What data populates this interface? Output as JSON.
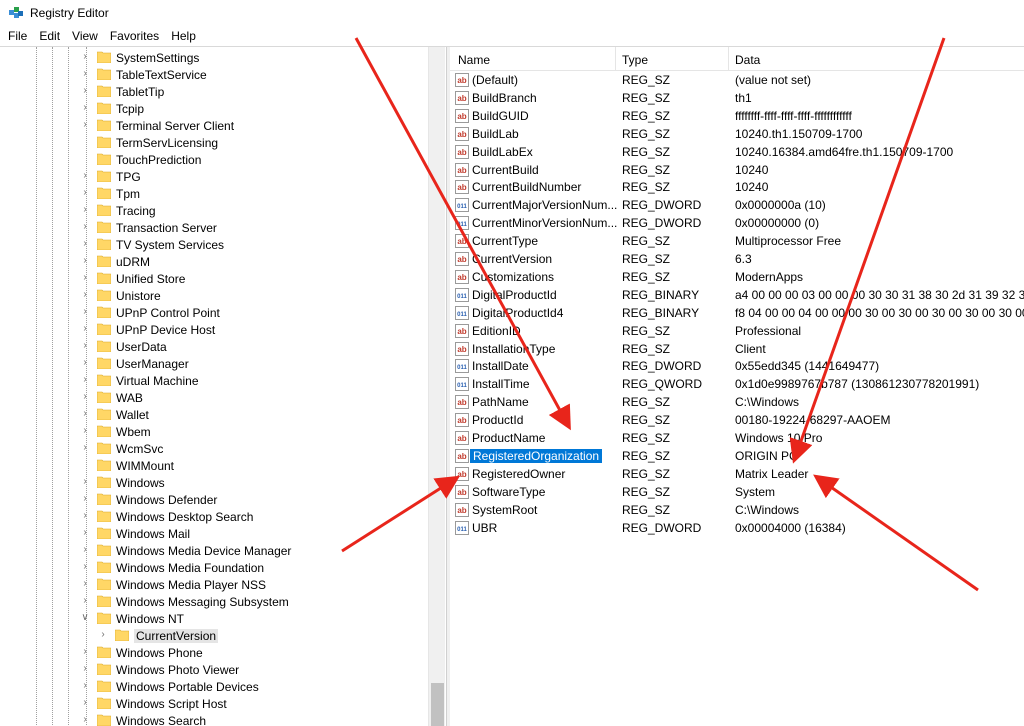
{
  "window": {
    "title": "Registry Editor",
    "icon": "regedit-icon"
  },
  "menu": [
    "File",
    "Edit",
    "View",
    "Favorites",
    "Help"
  ],
  "tree": {
    "items": [
      {
        "label": "SystemSettings",
        "expandable": true
      },
      {
        "label": "TableTextService",
        "expandable": true
      },
      {
        "label": "TabletTip",
        "expandable": true
      },
      {
        "label": "Tcpip",
        "expandable": true
      },
      {
        "label": "Terminal Server Client",
        "expandable": true
      },
      {
        "label": "TermServLicensing",
        "expandable": false
      },
      {
        "label": "TouchPrediction",
        "expandable": false
      },
      {
        "label": "TPG",
        "expandable": true
      },
      {
        "label": "Tpm",
        "expandable": true
      },
      {
        "label": "Tracing",
        "expandable": true
      },
      {
        "label": "Transaction Server",
        "expandable": true
      },
      {
        "label": "TV System Services",
        "expandable": true
      },
      {
        "label": "uDRM",
        "expandable": true
      },
      {
        "label": "Unified Store",
        "expandable": true
      },
      {
        "label": "Unistore",
        "expandable": true
      },
      {
        "label": "UPnP Control Point",
        "expandable": true
      },
      {
        "label": "UPnP Device Host",
        "expandable": true
      },
      {
        "label": "UserData",
        "expandable": true
      },
      {
        "label": "UserManager",
        "expandable": true
      },
      {
        "label": "Virtual Machine",
        "expandable": true
      },
      {
        "label": "WAB",
        "expandable": true
      },
      {
        "label": "Wallet",
        "expandable": true
      },
      {
        "label": "Wbem",
        "expandable": true
      },
      {
        "label": "WcmSvc",
        "expandable": true
      },
      {
        "label": "WIMMount",
        "expandable": false
      },
      {
        "label": "Windows",
        "expandable": true
      },
      {
        "label": "Windows Defender",
        "expandable": true
      },
      {
        "label": "Windows Desktop Search",
        "expandable": true
      },
      {
        "label": "Windows Mail",
        "expandable": true
      },
      {
        "label": "Windows Media Device Manager",
        "expandable": true
      },
      {
        "label": "Windows Media Foundation",
        "expandable": true
      },
      {
        "label": "Windows Media Player NSS",
        "expandable": true
      },
      {
        "label": "Windows Messaging Subsystem",
        "expandable": true
      },
      {
        "label": "Windows NT",
        "expandable": true,
        "expanded": true
      },
      {
        "label": "CurrentVersion",
        "expandable": true,
        "child": true,
        "selected": true
      },
      {
        "label": "Windows Phone",
        "expandable": true
      },
      {
        "label": "Windows Photo Viewer",
        "expandable": true
      },
      {
        "label": "Windows Portable Devices",
        "expandable": true
      },
      {
        "label": "Windows Script Host",
        "expandable": true
      },
      {
        "label": "Windows Search",
        "expandable": true
      }
    ]
  },
  "list": {
    "columns": {
      "name": "Name",
      "type": "Type",
      "data": "Data"
    },
    "values": [
      {
        "name": "(Default)",
        "type": "REG_SZ",
        "data": "(value not set)",
        "kind": "string"
      },
      {
        "name": "BuildBranch",
        "type": "REG_SZ",
        "data": "th1",
        "kind": "string"
      },
      {
        "name": "BuildGUID",
        "type": "REG_SZ",
        "data": "ffffffff-ffff-ffff-ffff-ffffffffffff",
        "kind": "string"
      },
      {
        "name": "BuildLab",
        "type": "REG_SZ",
        "data": "10240.th1.150709-1700",
        "kind": "string"
      },
      {
        "name": "BuildLabEx",
        "type": "REG_SZ",
        "data": "10240.16384.amd64fre.th1.150709-1700",
        "kind": "string"
      },
      {
        "name": "CurrentBuild",
        "type": "REG_SZ",
        "data": "10240",
        "kind": "string"
      },
      {
        "name": "CurrentBuildNumber",
        "type": "REG_SZ",
        "data": "10240",
        "kind": "string"
      },
      {
        "name": "CurrentMajorVersionNum...",
        "type": "REG_DWORD",
        "data": "0x0000000a (10)",
        "kind": "binary"
      },
      {
        "name": "CurrentMinorVersionNum...",
        "type": "REG_DWORD",
        "data": "0x00000000 (0)",
        "kind": "binary"
      },
      {
        "name": "CurrentType",
        "type": "REG_SZ",
        "data": "Multiprocessor Free",
        "kind": "string"
      },
      {
        "name": "CurrentVersion",
        "type": "REG_SZ",
        "data": "6.3",
        "kind": "string"
      },
      {
        "name": "Customizations",
        "type": "REG_SZ",
        "data": "ModernApps",
        "kind": "string"
      },
      {
        "name": "DigitalProductId",
        "type": "REG_BINARY",
        "data": "a4 00 00 00 03 00 00 00 30 30 31 38 30 2d 31 39 32 3...",
        "kind": "binary"
      },
      {
        "name": "DigitalProductId4",
        "type": "REG_BINARY",
        "data": "f8 04 00 00 04 00 00 00 30 00 30 00 30 00 30 00 30 00...",
        "kind": "binary"
      },
      {
        "name": "EditionID",
        "type": "REG_SZ",
        "data": "Professional",
        "kind": "string"
      },
      {
        "name": "InstallationType",
        "type": "REG_SZ",
        "data": "Client",
        "kind": "string"
      },
      {
        "name": "InstallDate",
        "type": "REG_DWORD",
        "data": "0x55edd345 (1441649477)",
        "kind": "binary"
      },
      {
        "name": "InstallTime",
        "type": "REG_QWORD",
        "data": "0x1d0e9989767b787 (130861230778201991)",
        "kind": "binary"
      },
      {
        "name": "PathName",
        "type": "REG_SZ",
        "data": "C:\\Windows",
        "kind": "string"
      },
      {
        "name": "ProductId",
        "type": "REG_SZ",
        "data": "00180-19224-68297-AAOEM",
        "kind": "string"
      },
      {
        "name": "ProductName",
        "type": "REG_SZ",
        "data": "Windows 10 Pro",
        "kind": "string"
      },
      {
        "name": "RegisteredOrganization",
        "type": "REG_SZ",
        "data": "ORIGIN PC",
        "kind": "string",
        "selected": true
      },
      {
        "name": "RegisteredOwner",
        "type": "REG_SZ",
        "data": "Matrix Leader",
        "kind": "string"
      },
      {
        "name": "SoftwareType",
        "type": "REG_SZ",
        "data": "System",
        "kind": "string"
      },
      {
        "name": "SystemRoot",
        "type": "REG_SZ",
        "data": "C:\\Windows",
        "kind": "string"
      },
      {
        "name": "UBR",
        "type": "REG_DWORD",
        "data": "0x00004000 (16384)",
        "kind": "binary"
      }
    ]
  },
  "colors": {
    "selection": "#0078d7",
    "arrow": "#e8251b",
    "folder": "#ffd766",
    "string_icon": "#c0392b",
    "binary_icon": "#2a5fb0"
  },
  "annotations": {
    "arrow_count": 5,
    "arrow_color": "#e8251b"
  }
}
